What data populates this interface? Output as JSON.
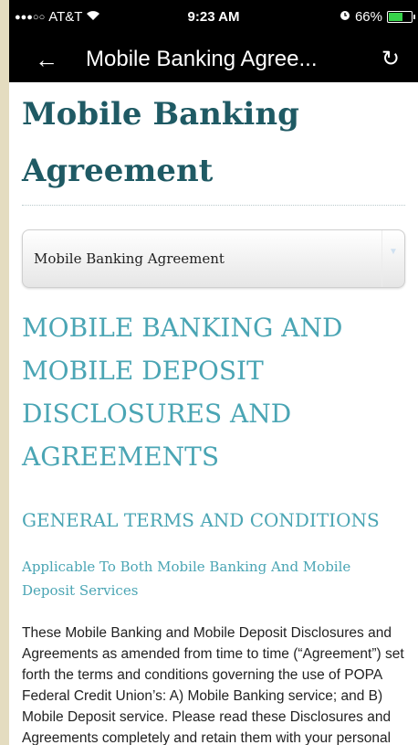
{
  "status": {
    "signal": "●●●○○",
    "carrier": "AT&T",
    "wifi_icon": "wifi-icon",
    "time": "9:23 AM",
    "alarm_icon": "alarm-icon",
    "battery_percent": "66%",
    "battery_level": 0.66
  },
  "nav": {
    "back_glyph": "←",
    "title": "Mobile Banking Agree...",
    "refresh_glyph": "↻"
  },
  "page": {
    "title_line1": "Mobile Banking",
    "title_line2": "Agreement",
    "select_value": "Mobile Banking Agreement",
    "heading1_lines": [
      "MOBILE BANKING AND",
      "MOBILE DEPOSIT",
      "DISCLOSURES AND",
      "AGREEMENTS"
    ],
    "heading2": "GENERAL TERMS AND CONDITIONS",
    "heading3": "Applicable To Both Mobile Banking And Mobile Deposit Services",
    "body": "These Mobile Banking and Mobile Deposit Disclosures and Agreements as amended from time to time (“Agreement”) set forth the terms and conditions governing the use of POPA Federal Credit Union’s: A) Mobile Banking service; and B) Mobile Deposit service. Please read these Disclosures and Agreements completely and retain them with your personal records."
  },
  "colors": {
    "title": "#1f5a64",
    "heading": "#4aa5b4",
    "bar": "#000000",
    "page_bg": "#e4dcc0"
  }
}
